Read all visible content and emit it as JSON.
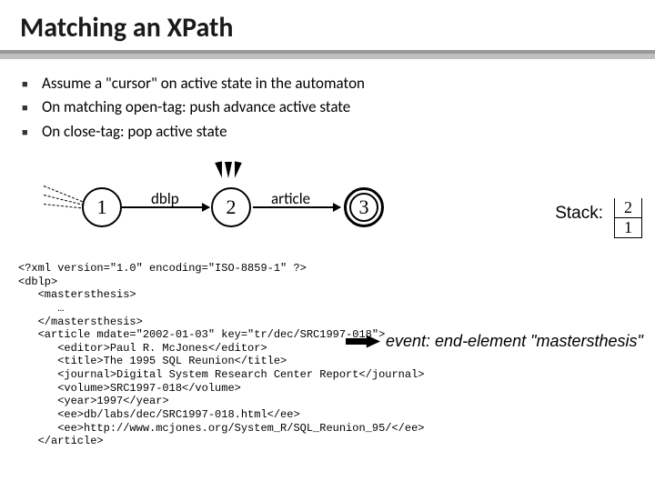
{
  "title": "Matching an XPath",
  "bullets": [
    "Assume a \"cursor\" on active state in the automaton",
    "On matching open-tag:  push advance active state",
    "On close-tag:  pop active state"
  ],
  "automaton": {
    "state1": "1",
    "state2": "2",
    "state3": "3",
    "edge12": "dblp",
    "edge23": "article"
  },
  "stack": {
    "label": "Stack:",
    "cells": {
      "top": "2",
      "bottom": "1"
    }
  },
  "event": {
    "text": "event:  end-element \"mastersthesis\""
  },
  "xml_lines": "<?xml version=\"1.0\" encoding=\"ISO-8859-1\" ?>\n<dblp>\n   <mastersthesis>\n      …\n   </mastersthesis>\n   <article mdate=\"2002-01-03\" key=\"tr/dec/SRC1997-018\">\n      <editor>Paul R. McJones</editor>\n      <title>The 1995 SQL Reunion</title>\n      <journal>Digital System Research Center Report</journal>\n      <volume>SRC1997-018</volume>\n      <year>1997</year>\n      <ee>db/labs/dec/SRC1997-018.html</ee>\n      <ee>http://www.mcjones.org/System_R/SQL_Reunion_95/</ee>\n   </article>"
}
